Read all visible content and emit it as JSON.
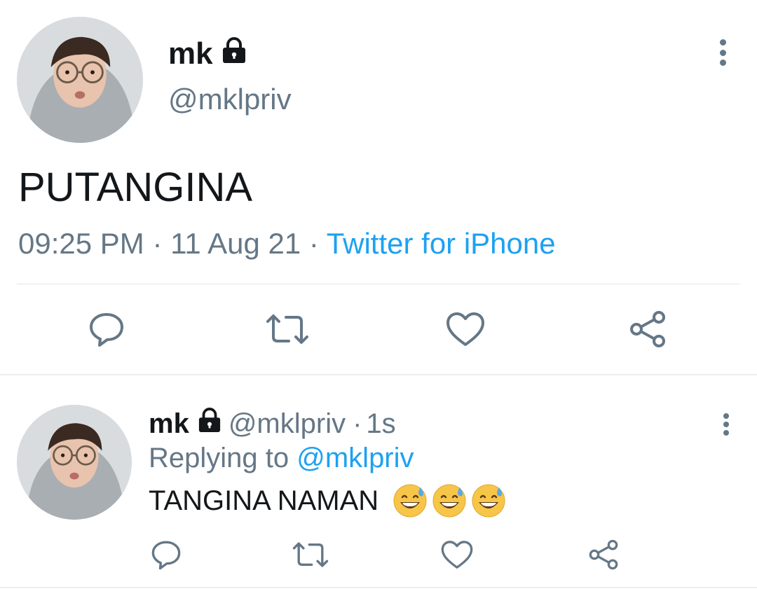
{
  "tweet": {
    "author_name": "mk",
    "author_handle": "@mklpriv",
    "text": "PUTANGINA",
    "time": "09:25 PM",
    "date": "11 Aug 21",
    "separator": "·",
    "source": "Twitter for iPhone",
    "actions": [
      "reply-icon",
      "retweet-icon",
      "like-icon",
      "share-icon"
    ]
  },
  "reply": {
    "author_name": "mk",
    "author_handle": "@mklpriv",
    "age": "1s",
    "replying_prefix": "Replying to",
    "replying_to": "@mklpriv",
    "text": "TANGINA NAMAN",
    "emojis": [
      "grinning-sweat-emoji",
      "grinning-sweat-emoji",
      "grinning-sweat-emoji"
    ]
  },
  "colors": {
    "text": "#14171a",
    "secondary": "#657786",
    "accent": "#1da1f2",
    "divider": "#e1e8ed"
  }
}
